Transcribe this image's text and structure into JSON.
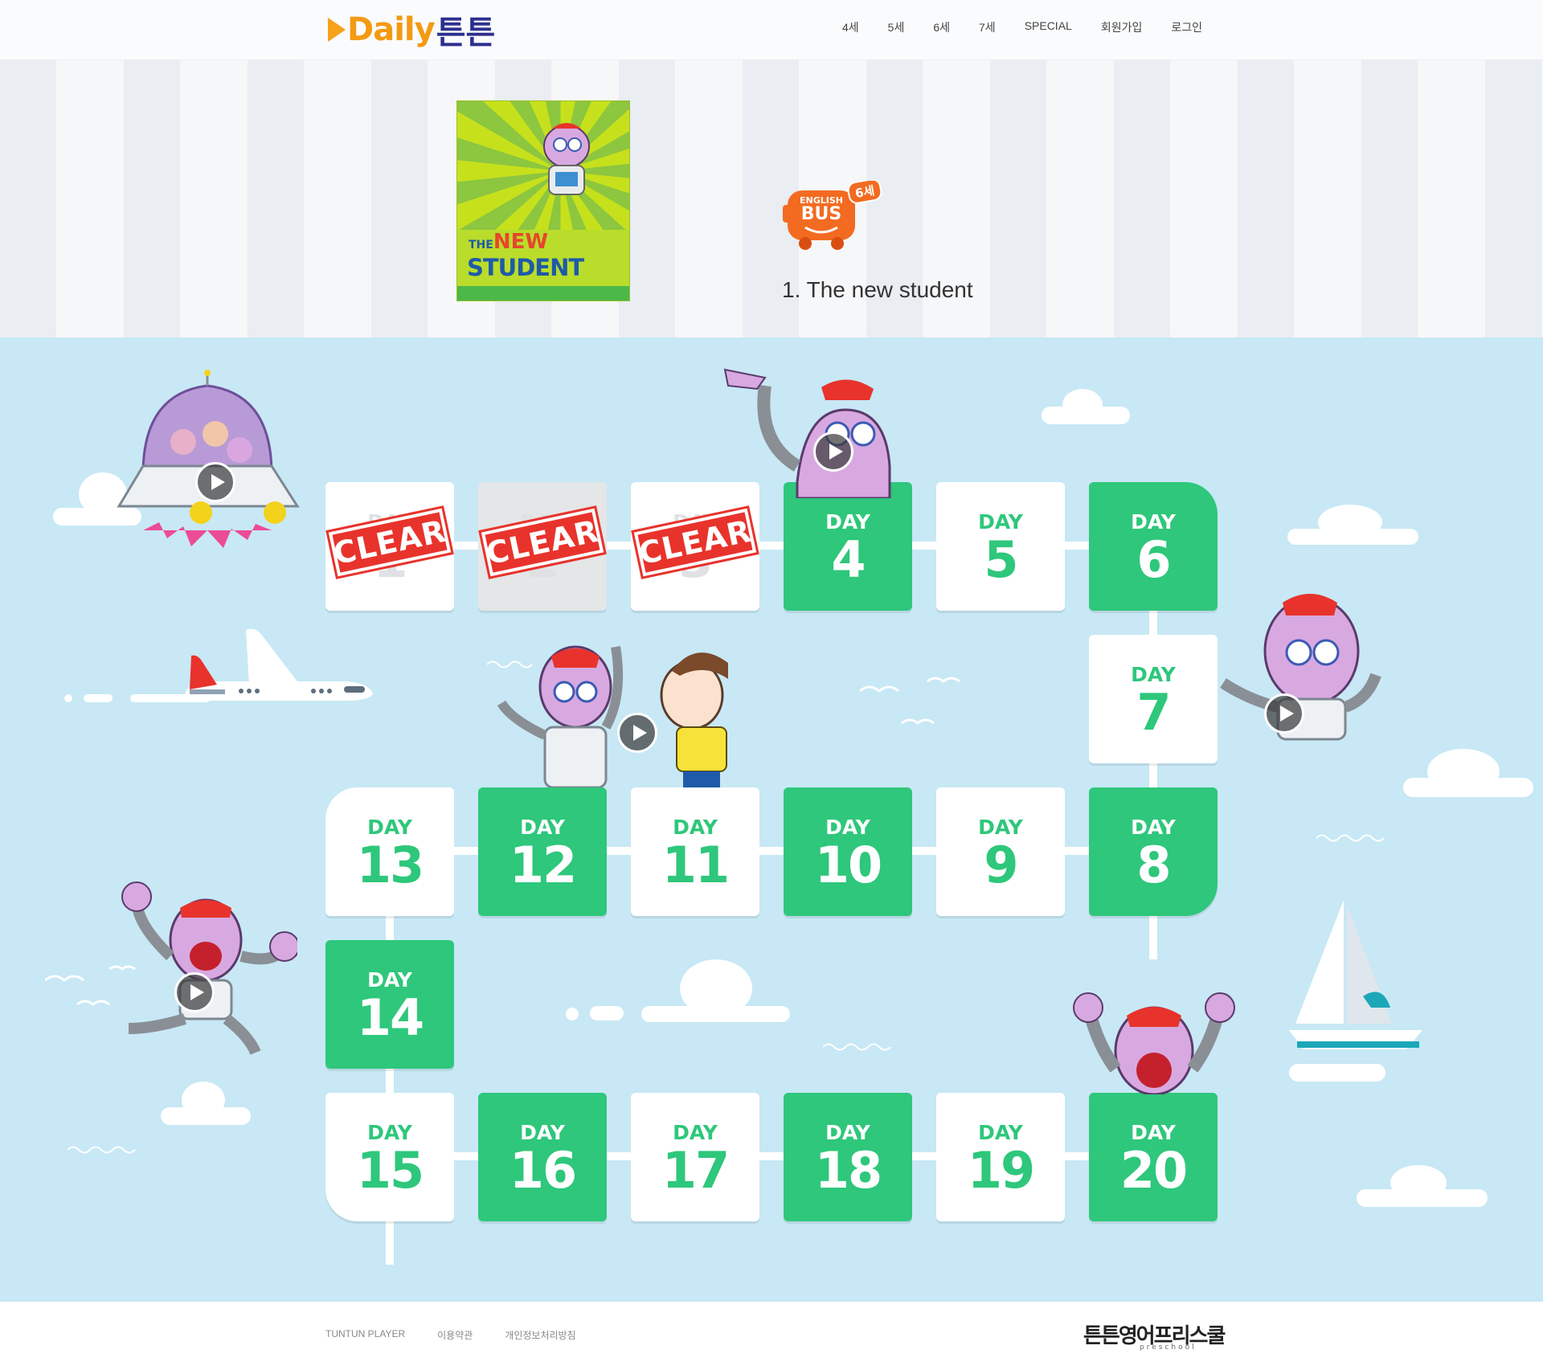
{
  "header": {
    "logo_latin": "Daily",
    "logo_korean": "튼튼",
    "nav": [
      "4세",
      "5세",
      "6세",
      "7세",
      "SPECIAL",
      "회원가입",
      "로그인"
    ]
  },
  "hero": {
    "book_title_small": "THE",
    "book_title_new": "NEW",
    "book_title_student": "STUDENT",
    "badge_english": "ENGLISH",
    "badge_bus": "BUS",
    "badge_age": "6세",
    "lesson_title": "1. The new student"
  },
  "board": {
    "day_label": "DAY",
    "clear_label": "CLEAR",
    "days": [
      {
        "num": "1",
        "status": "clear"
      },
      {
        "num": "2",
        "status": "clear"
      },
      {
        "num": "3",
        "status": "clear"
      },
      {
        "num": "4",
        "status": "green"
      },
      {
        "num": "5",
        "status": "white"
      },
      {
        "num": "6",
        "status": "green"
      },
      {
        "num": "7",
        "status": "white"
      },
      {
        "num": "8",
        "status": "green"
      },
      {
        "num": "9",
        "status": "white"
      },
      {
        "num": "10",
        "status": "green"
      },
      {
        "num": "11",
        "status": "white"
      },
      {
        "num": "12",
        "status": "green"
      },
      {
        "num": "13",
        "status": "white"
      },
      {
        "num": "14",
        "status": "green"
      },
      {
        "num": "15",
        "status": "white"
      },
      {
        "num": "16",
        "status": "green"
      },
      {
        "num": "17",
        "status": "white"
      },
      {
        "num": "18",
        "status": "green"
      },
      {
        "num": "19",
        "status": "white"
      },
      {
        "num": "20",
        "status": "green"
      }
    ]
  },
  "footer": {
    "links": [
      "TUNTUN PLAYER",
      "이용약관",
      "개인정보처리방침"
    ],
    "brand": "튼튼영어프리스쿨",
    "brand_sub": "preschool"
  },
  "colors": {
    "green": "#2ec77b",
    "sky": "#c8e8f5",
    "clear_red": "#e8332c",
    "bus_orange": "#f26b21"
  }
}
